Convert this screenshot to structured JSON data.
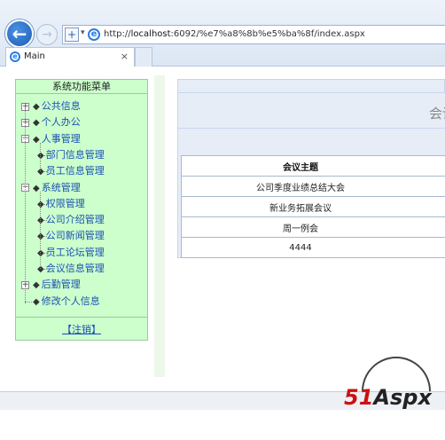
{
  "browser": {
    "url_prefix": "http://",
    "url_host": "localhost",
    "url_rest": ":6092/%e7%a8%8b%e5%ba%8f/index.aspx",
    "tab_title": "Main",
    "tab_close": "×"
  },
  "menu": {
    "title": "系统功能菜单",
    "items": [
      {
        "label": "公共信息",
        "level": 0,
        "toggle": "+"
      },
      {
        "label": "个人办公",
        "level": 0,
        "toggle": "+"
      },
      {
        "label": "人事管理",
        "level": 0,
        "toggle": "-"
      },
      {
        "label": "部门信息管理",
        "level": 1
      },
      {
        "label": "员工信息管理",
        "level": 1
      },
      {
        "label": "系统管理",
        "level": 0,
        "toggle": "-"
      },
      {
        "label": "权限管理",
        "level": 1
      },
      {
        "label": "公司介绍管理",
        "level": 1
      },
      {
        "label": "公司新闻管理",
        "level": 1
      },
      {
        "label": "员工论坛管理",
        "level": 1
      },
      {
        "label": "会议信息管理",
        "level": 1
      },
      {
        "label": "后勤管理",
        "level": 0,
        "toggle": "+"
      },
      {
        "label": "修改个人信息",
        "level": 0
      }
    ],
    "logout": "【注销】"
  },
  "content": {
    "header_title": "会议",
    "table": {
      "header": "会议主题",
      "rows": [
        "公司季度业绩总结大会",
        "新业务拓展会议",
        "周一例会",
        "4444"
      ]
    }
  },
  "watermark": {
    "part1": "51",
    "part2": "Aspx"
  }
}
